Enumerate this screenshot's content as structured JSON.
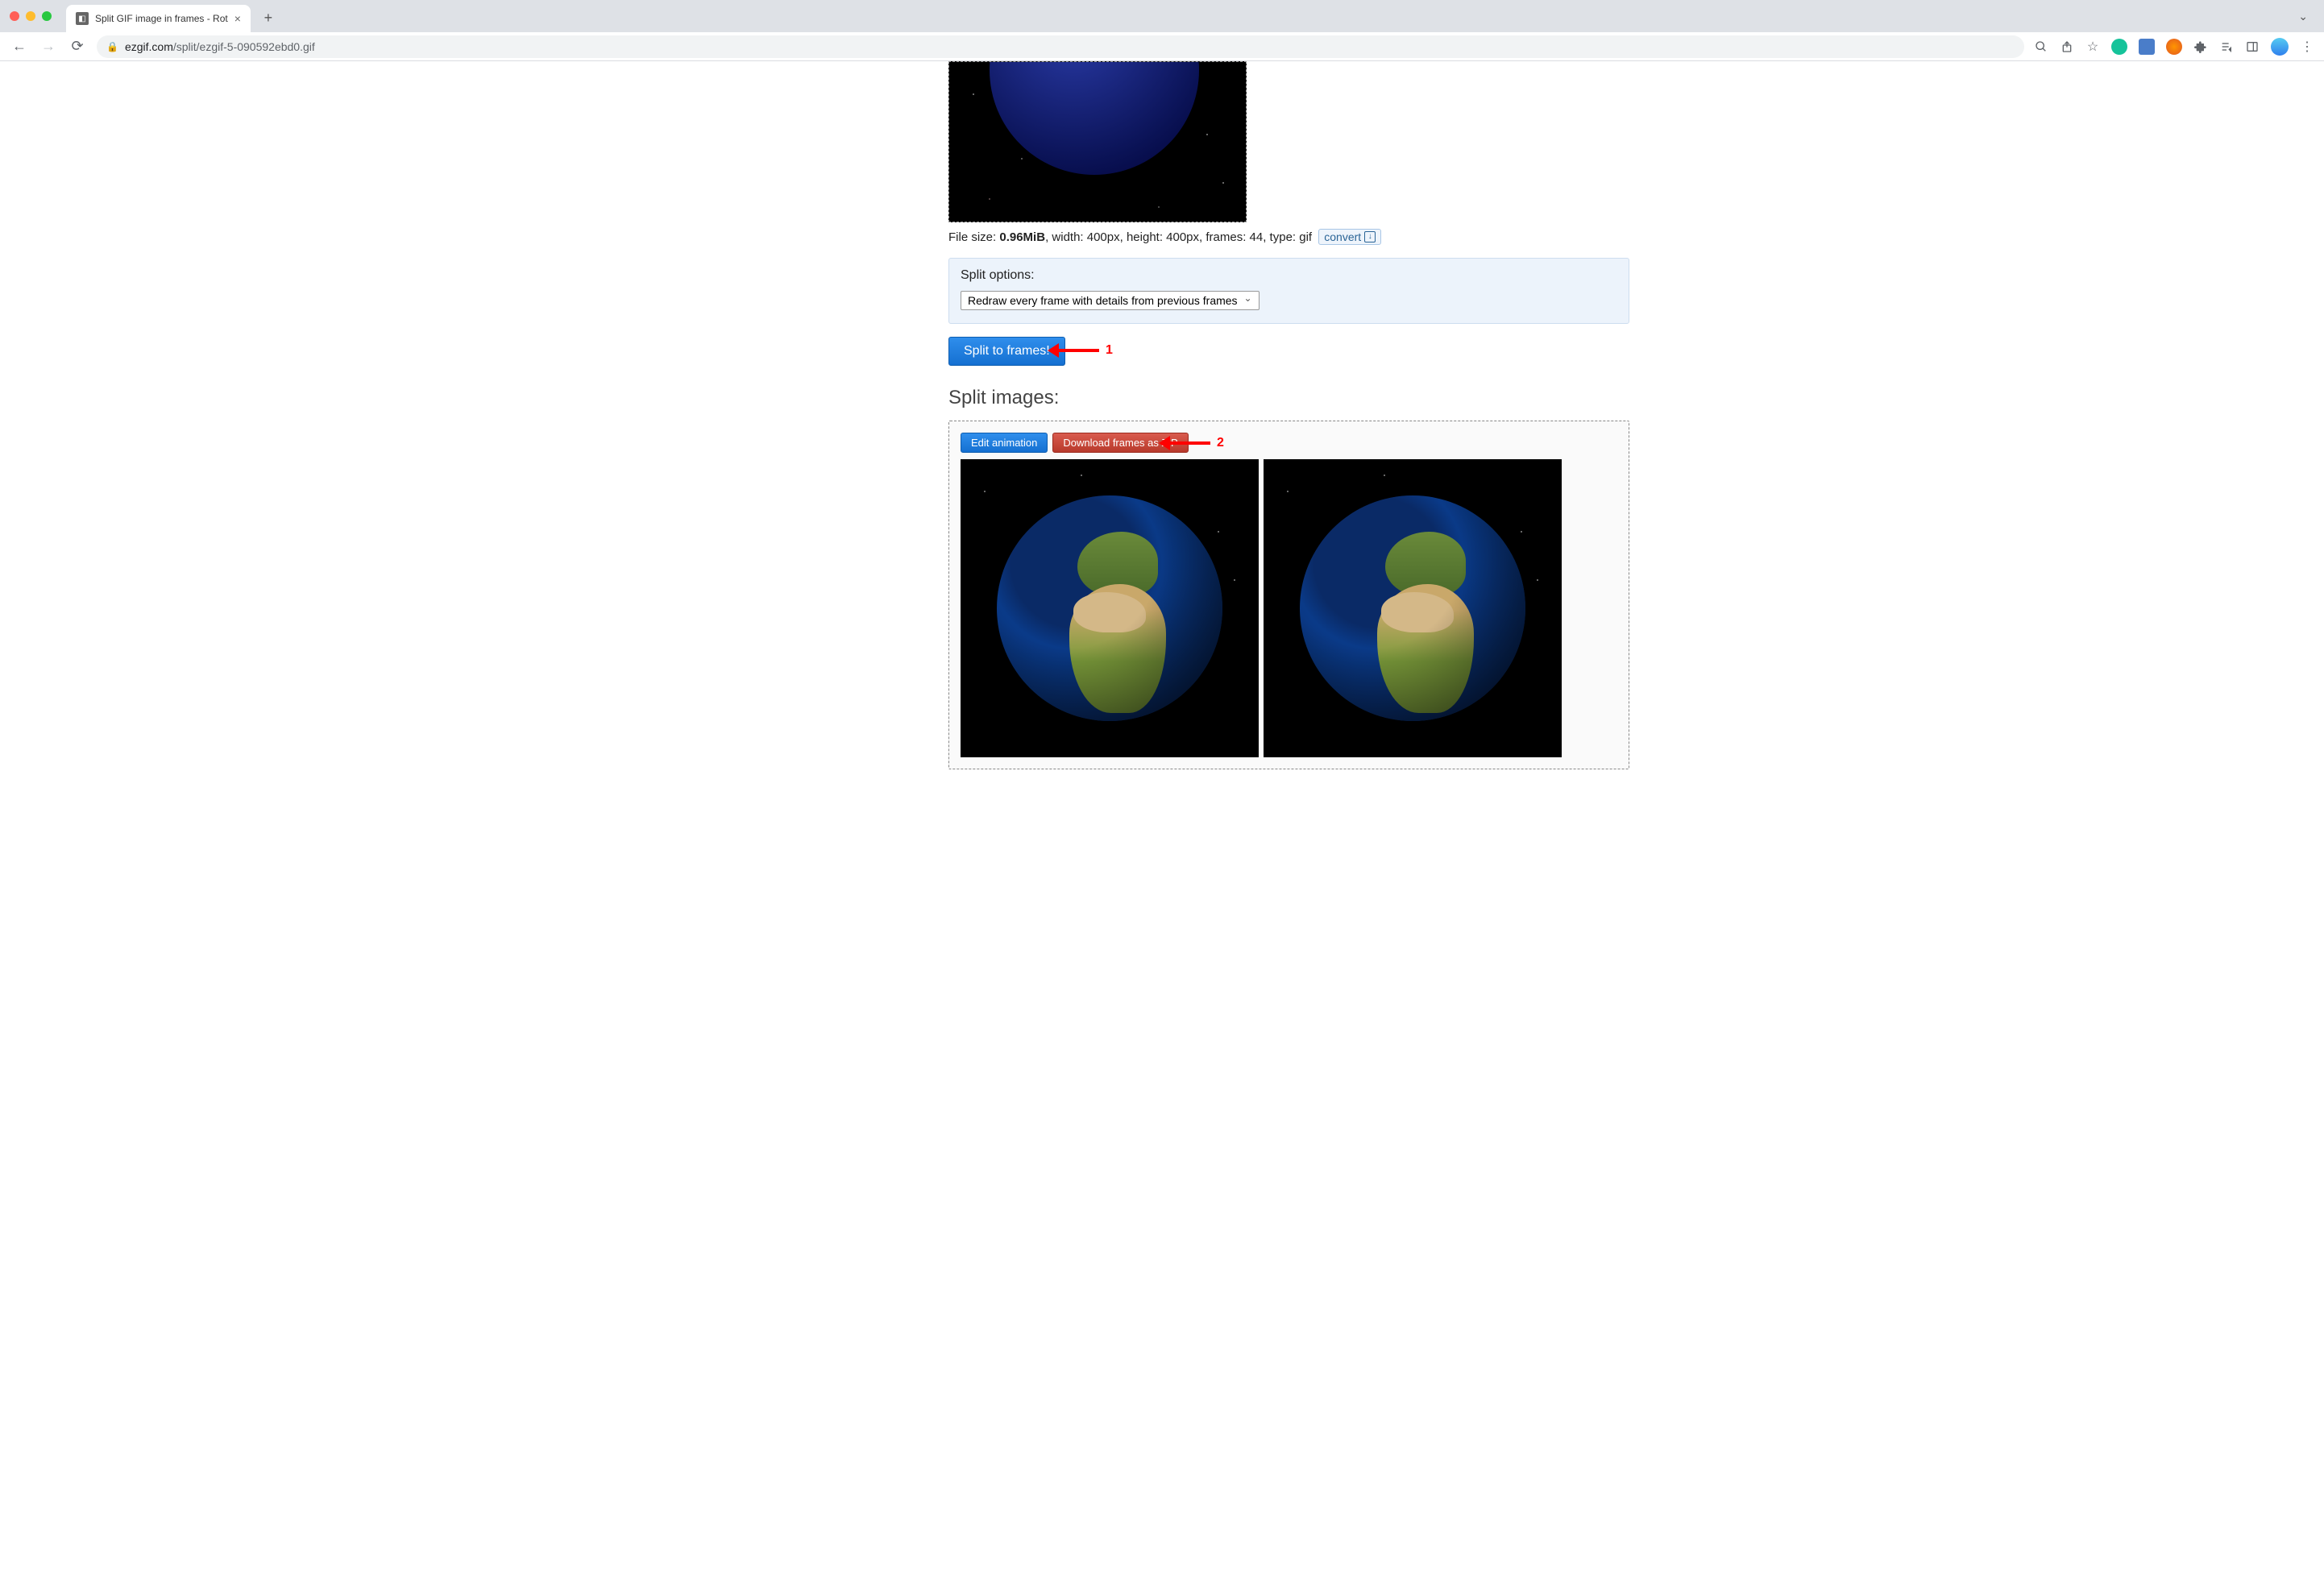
{
  "browser": {
    "tab_title": "Split GIF image in frames - Rot",
    "url_host": "ezgif.com",
    "url_path": "/split/ezgif-5-090592ebd0.gif"
  },
  "file_info": {
    "label_file_size": "File size: ",
    "file_size": "0.96MiB",
    "rest": ", width: 400px, height: 400px, frames: 44, type: gif",
    "convert_label": "convert"
  },
  "split_options": {
    "heading": "Split options:",
    "selected": "Redraw every frame with details from previous frames"
  },
  "buttons": {
    "split_label": "Split to frames!",
    "edit_animation": "Edit animation",
    "download_zip": "Download frames as ZIP"
  },
  "headings": {
    "split_images": "Split images:"
  },
  "annotations": {
    "arrow1": "1",
    "arrow2": "2"
  }
}
